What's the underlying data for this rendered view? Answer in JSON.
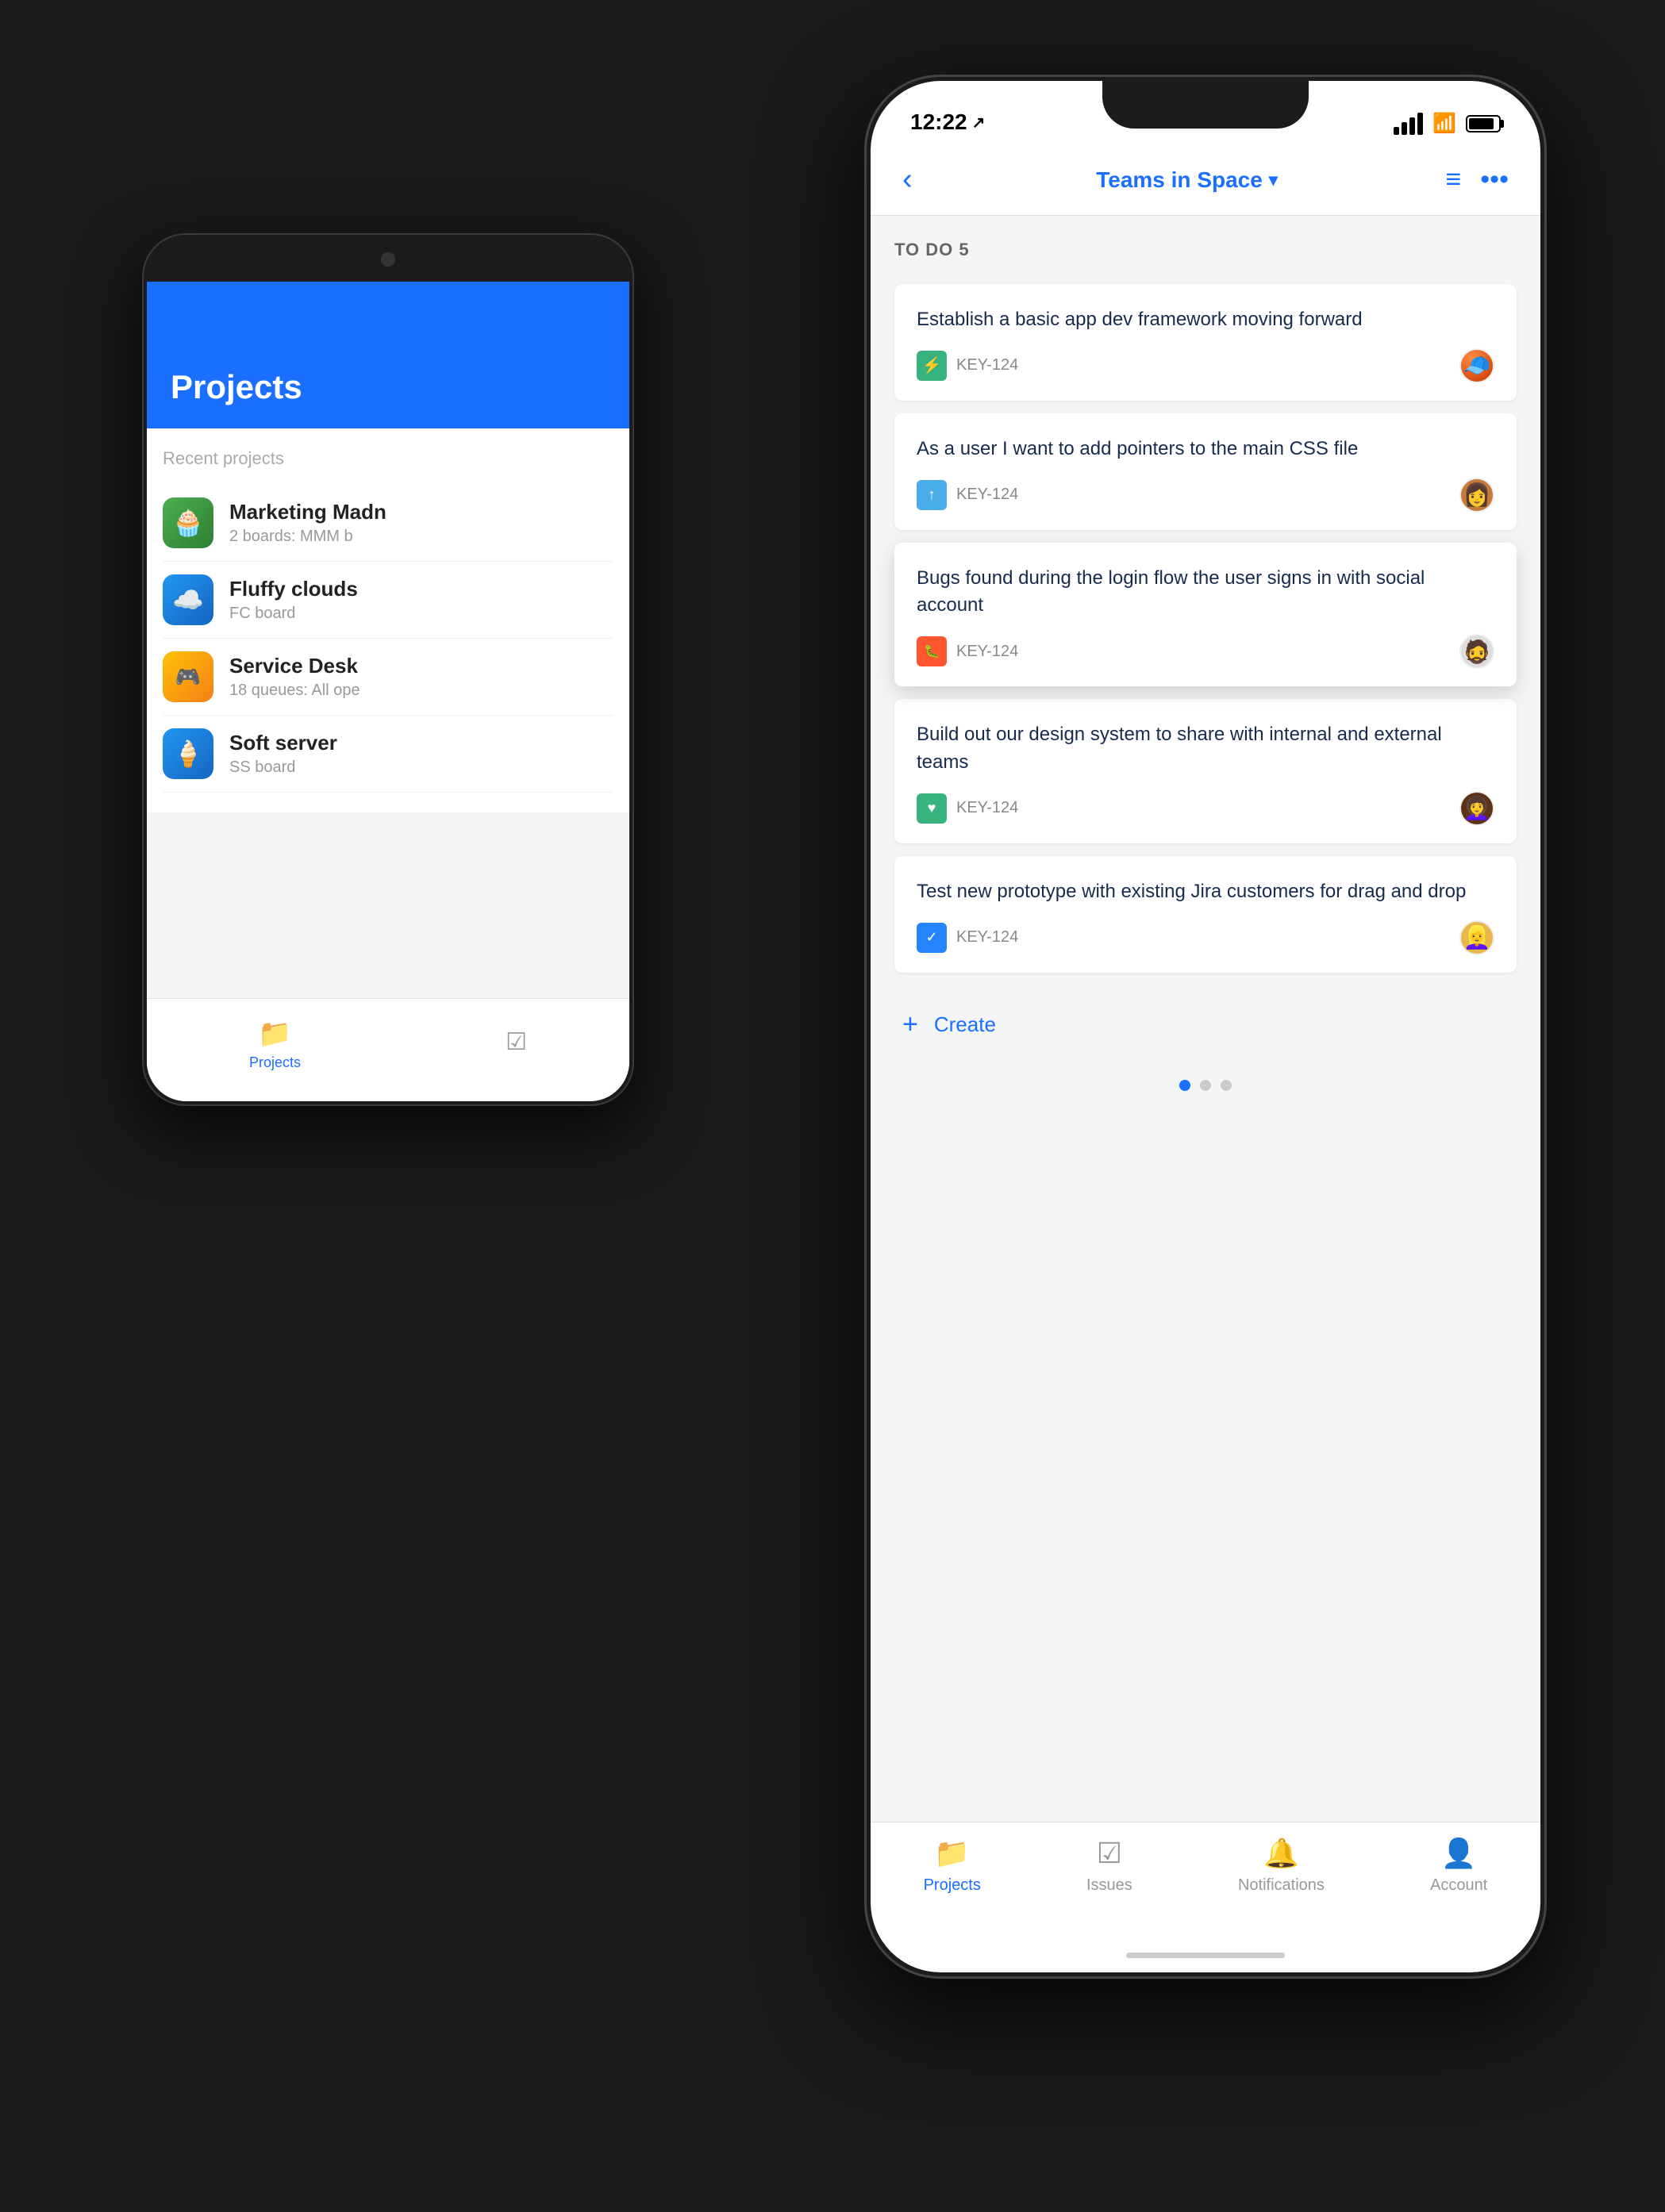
{
  "scene": {
    "background": "#1a1a1a"
  },
  "backPhone": {
    "header": {
      "title": "Projects"
    },
    "recentSection": "Recent projects",
    "projects": [
      {
        "id": "marketing",
        "name": "Marketing Madn",
        "subtitle": "2 boards: MMM b",
        "iconClass": "icon-marketing",
        "emoji": "🧁"
      },
      {
        "id": "fluffy",
        "name": "Fluffy clouds",
        "subtitle": "FC board",
        "iconClass": "icon-fluffy",
        "emoji": "☁️"
      },
      {
        "id": "service",
        "name": "Service Desk",
        "subtitle": "18 queues: All ope",
        "iconClass": "icon-service",
        "emoji": "🎮"
      },
      {
        "id": "soft",
        "name": "Soft server",
        "subtitle": "SS board",
        "iconClass": "icon-soft",
        "emoji": "🍦"
      }
    ],
    "bottomNav": [
      {
        "label": "Projects",
        "active": true
      },
      {
        "label": "",
        "active": false
      }
    ]
  },
  "frontPhone": {
    "statusBar": {
      "time": "12:22",
      "hasLocationArrow": true
    },
    "navBar": {
      "backLabel": "‹",
      "title": "Teams in Space",
      "hasDropdown": true,
      "rightIcons": [
        "list-icon",
        "more-icon"
      ]
    },
    "sectionHeader": {
      "label": "TO DO",
      "count": "5"
    },
    "tasks": [
      {
        "id": 1,
        "title": "Establish a basic app dev framework moving forward",
        "key": "KEY-124",
        "typeIcon": "⚡",
        "typeIconClass": "icon-story",
        "highlighted": false
      },
      {
        "id": 2,
        "title": "As a user I want to add pointers to the main CSS file",
        "key": "KEY-124",
        "typeIcon": "↑",
        "typeIconClass": "icon-task",
        "highlighted": false
      },
      {
        "id": 3,
        "title": "Bugs found during the login flow the user signs in with social account",
        "key": "KEY-124",
        "typeIcon": "🐛",
        "typeIconClass": "icon-bug",
        "highlighted": true
      },
      {
        "id": 4,
        "title": "Build out our design system to share with internal and external teams",
        "key": "KEY-124",
        "typeIcon": "♥",
        "typeIconClass": "icon-improvement",
        "highlighted": false
      },
      {
        "id": 5,
        "title": "Test new prototype with existing Jira customers for drag and drop",
        "key": "KEY-124",
        "typeIcon": "✓",
        "typeIconClass": "icon-checkbox",
        "highlighted": false
      }
    ],
    "createButton": {
      "label": "Create",
      "icon": "+"
    },
    "paginationDots": [
      {
        "active": true
      },
      {
        "active": false
      },
      {
        "active": false
      }
    ],
    "bottomNav": [
      {
        "id": "projects",
        "label": "Projects",
        "icon": "📁",
        "active": true
      },
      {
        "id": "issues",
        "label": "Issues",
        "icon": "☑",
        "active": false
      },
      {
        "id": "notifications",
        "label": "Notifications",
        "icon": "🔔",
        "active": false
      },
      {
        "id": "account",
        "label": "Account",
        "icon": "👤",
        "active": false
      }
    ]
  }
}
